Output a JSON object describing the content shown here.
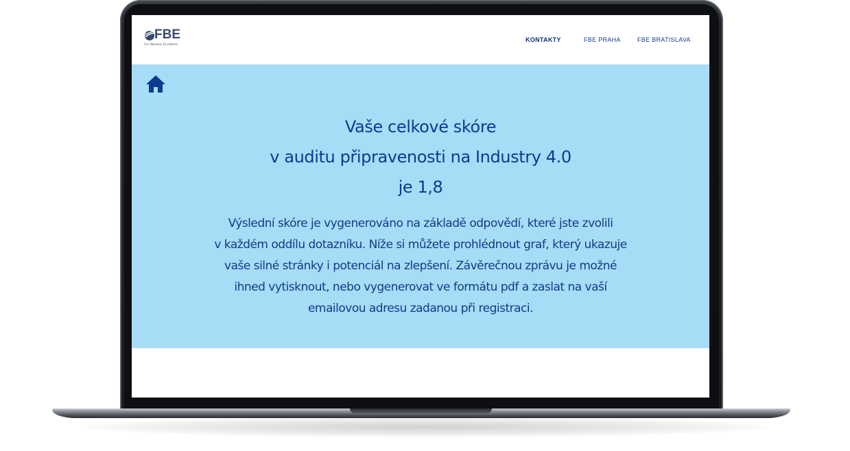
{
  "header": {
    "logo": {
      "name": "FBE",
      "tagline": "For Business Excellence"
    },
    "nav": [
      {
        "label": "KONTAKTY"
      },
      {
        "label": "FBE PRAHA"
      },
      {
        "label": "FBE BRATISLAVA"
      }
    ]
  },
  "hero": {
    "home_icon": "home-icon",
    "title_lines": [
      "Vaše celkové skóre",
      "v auditu připravenosti na  Industry 4.0",
      "je 1,8"
    ],
    "body_lines": [
      "Výslední skóre je vygenerováno na základě odpovědí, které jste zvolili",
      "v každém oddílu dotazníku. Níže si můžete prohlédnout graf, který ukazuje",
      "vaše silné stránky i potenciál na zlepšení. Závěrečnou zprávu je možné",
      "ihned vytisknout, nebo vygenerovat ve formátu pdf a zaslat na vaší",
      "emailovou adresu zadanou při registraci."
    ]
  },
  "colors": {
    "hero_background": "#a6dcf6",
    "brand_blue": "#0e3a8f",
    "page_background": "#ffffff",
    "device_frame": "#1a1c20"
  }
}
